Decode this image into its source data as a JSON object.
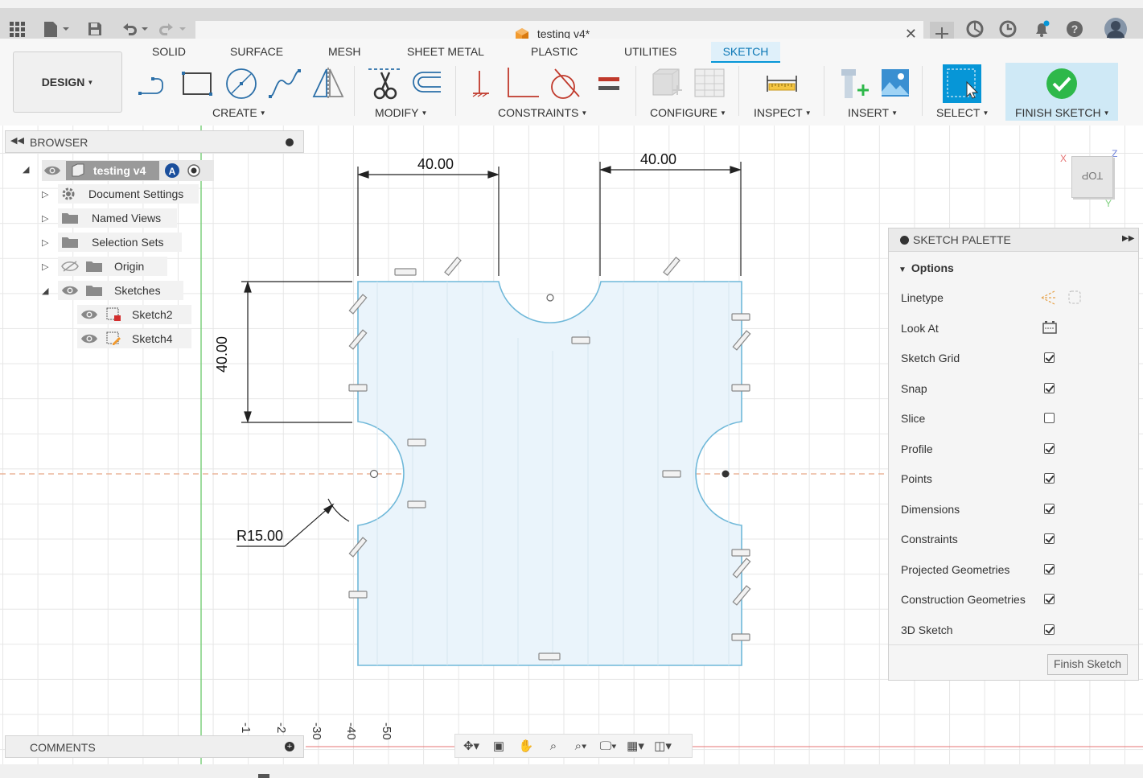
{
  "document": {
    "title": "testing v4*"
  },
  "ribbon": {
    "workspace": "DESIGN",
    "tabs": [
      "SOLID",
      "SURFACE",
      "MESH",
      "SHEET METAL",
      "PLASTIC",
      "UTILITIES",
      "SKETCH"
    ],
    "active_tab": "SKETCH",
    "groups": {
      "create": "CREATE",
      "modify": "MODIFY",
      "constraints": "CONSTRAINTS",
      "configure": "CONFIGURE",
      "inspect": "INSPECT",
      "insert": "INSERT",
      "select": "SELECT",
      "finish": "FINISH SKETCH"
    }
  },
  "browser": {
    "title": "BROWSER",
    "root": "testing v4",
    "items": [
      "Document Settings",
      "Named Views",
      "Selection Sets",
      "Origin",
      "Sketches"
    ],
    "sketches": [
      "Sketch2",
      "Sketch4"
    ]
  },
  "comments": {
    "title": "COMMENTS"
  },
  "sketch": {
    "dimensions": {
      "top_left_width": "40.00",
      "top_right_width": "40.00",
      "left_height": "40.00",
      "radius": "R15.00"
    },
    "ruler_labels": [
      "-1",
      "-2",
      "-30",
      "-40",
      "-50"
    ]
  },
  "viewcube": {
    "face": "TOP",
    "axis_x": "X",
    "axis_y": "Y",
    "axis_z": "Z"
  },
  "palette": {
    "title": "SKETCH PALETTE",
    "section": "Options",
    "linetype": "Linetype",
    "look_at": "Look At",
    "options": [
      {
        "label": "Sketch Grid",
        "checked": true
      },
      {
        "label": "Snap",
        "checked": true
      },
      {
        "label": "Slice",
        "checked": false
      },
      {
        "label": "Profile",
        "checked": true
      },
      {
        "label": "Points",
        "checked": true
      },
      {
        "label": "Dimensions",
        "checked": true
      },
      {
        "label": "Constraints",
        "checked": true
      },
      {
        "label": "Projected Geometries",
        "checked": true
      },
      {
        "label": "Construction Geometries",
        "checked": true
      },
      {
        "label": "3D Sketch",
        "checked": true
      }
    ],
    "finish_button": "Finish Sketch"
  },
  "colors": {
    "sketch_fill": "#eaf4fb",
    "sketch_line": "#6fb8d9",
    "accent": "#0696d7",
    "finish": "#2eb84a"
  }
}
